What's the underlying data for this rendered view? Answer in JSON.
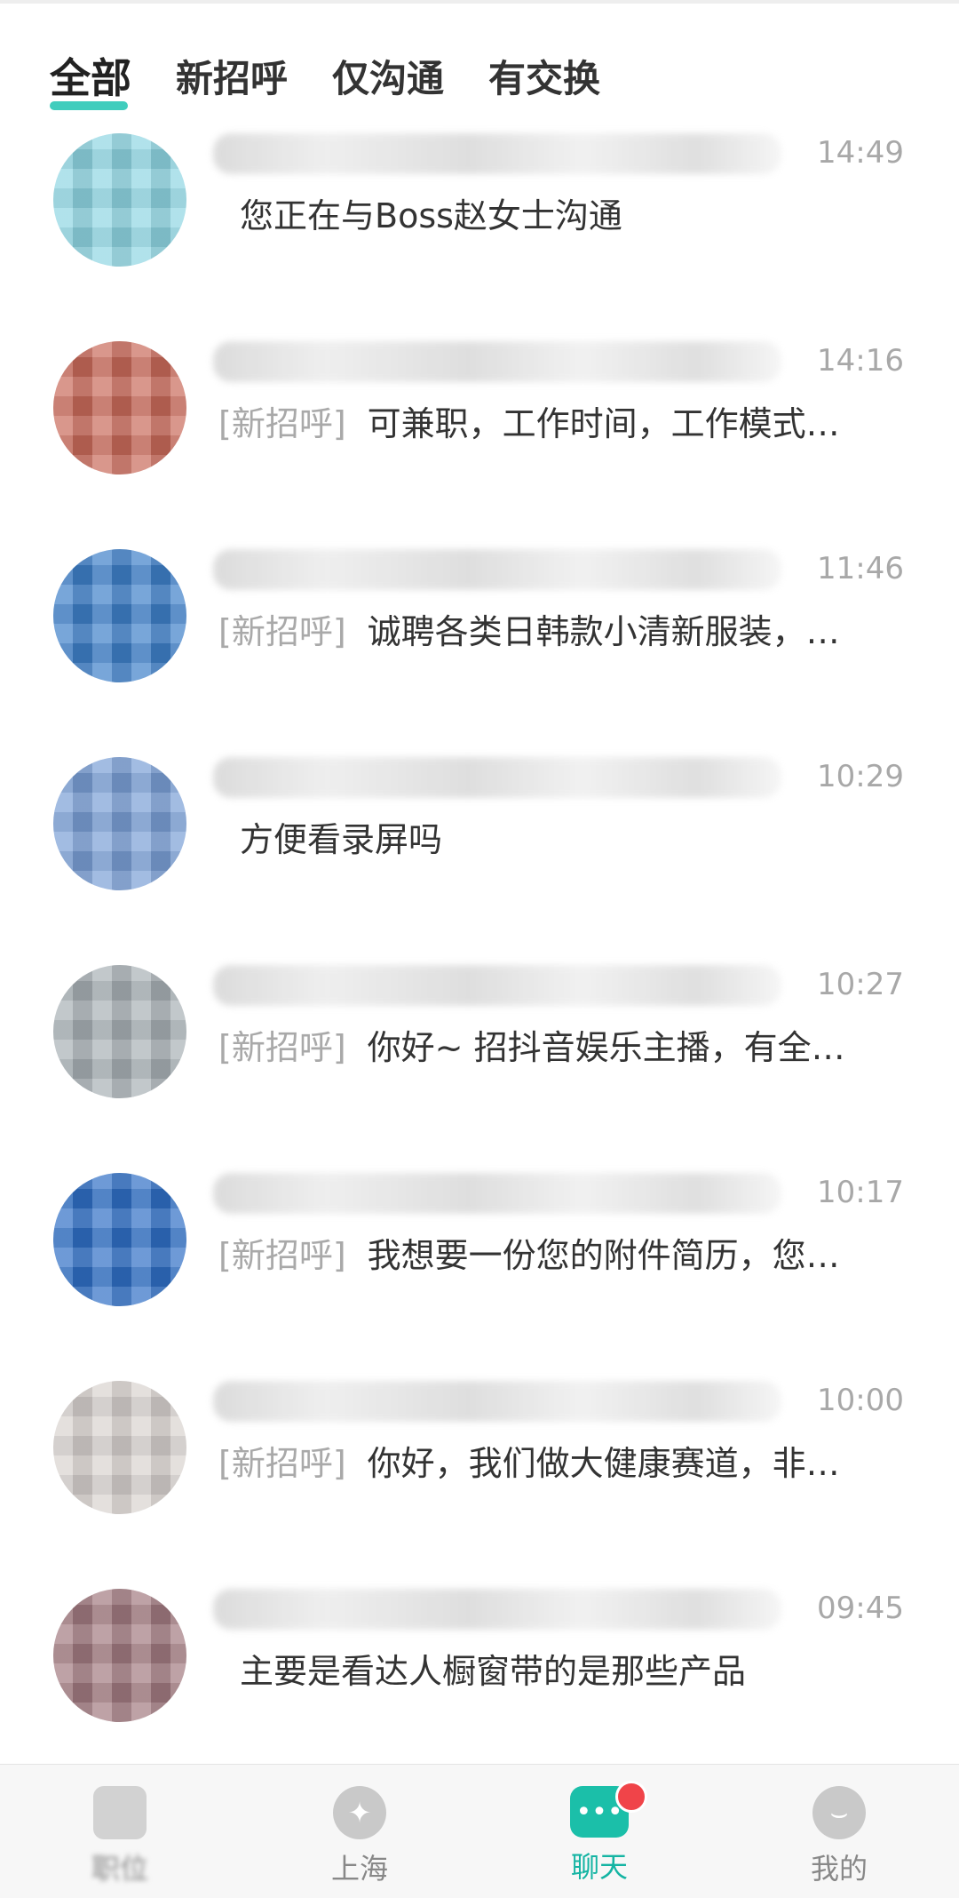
{
  "tabs": [
    {
      "label": "全部",
      "active": true
    },
    {
      "label": "新招呼",
      "active": false
    },
    {
      "label": "仅沟通",
      "active": false
    },
    {
      "label": "有交换",
      "active": false
    }
  ],
  "chats": [
    {
      "time": "14:49",
      "tag": "",
      "message": "您正在与Boss赵女士沟通"
    },
    {
      "time": "14:16",
      "tag": "[新招呼]",
      "message": "可兼职，工作时间，工作模式…"
    },
    {
      "time": "11:46",
      "tag": "[新招呼]",
      "message": "诚聘各类日韩款小清新服装，…"
    },
    {
      "time": "10:29",
      "tag": "",
      "message": "方便看录屏吗"
    },
    {
      "time": "10:27",
      "tag": "[新招呼]",
      "message": "你好~ 招抖音娱乐主播，有全…"
    },
    {
      "time": "10:17",
      "tag": "[新招呼]",
      "message": "我想要一份您的附件简历，您…"
    },
    {
      "time": "10:00",
      "tag": "[新招呼]",
      "message": "你好，我们做大健康赛道，非…"
    },
    {
      "time": "09:45",
      "tag": "",
      "message": "主要是看达人橱窗带的是那些产品"
    }
  ],
  "avatar_colors": [
    "#8fd6e3",
    "#c96a5a",
    "#3e7fc9",
    "#7a9fd6",
    "#a8b0b5",
    "#2f6fc5",
    "#d8d2cf",
    "#a27a80"
  ],
  "nav": [
    {
      "label": "职位",
      "icon": "job-icon"
    },
    {
      "label": "上海",
      "icon": "leaf-icon"
    },
    {
      "label": "聊天",
      "icon": "chat-icon",
      "active": true
    },
    {
      "label": "我的",
      "icon": "smile-icon"
    }
  ],
  "colors": {
    "accent": "#1bbfa9",
    "badge": "#f04449",
    "muted_text": "#a9a9a9"
  }
}
